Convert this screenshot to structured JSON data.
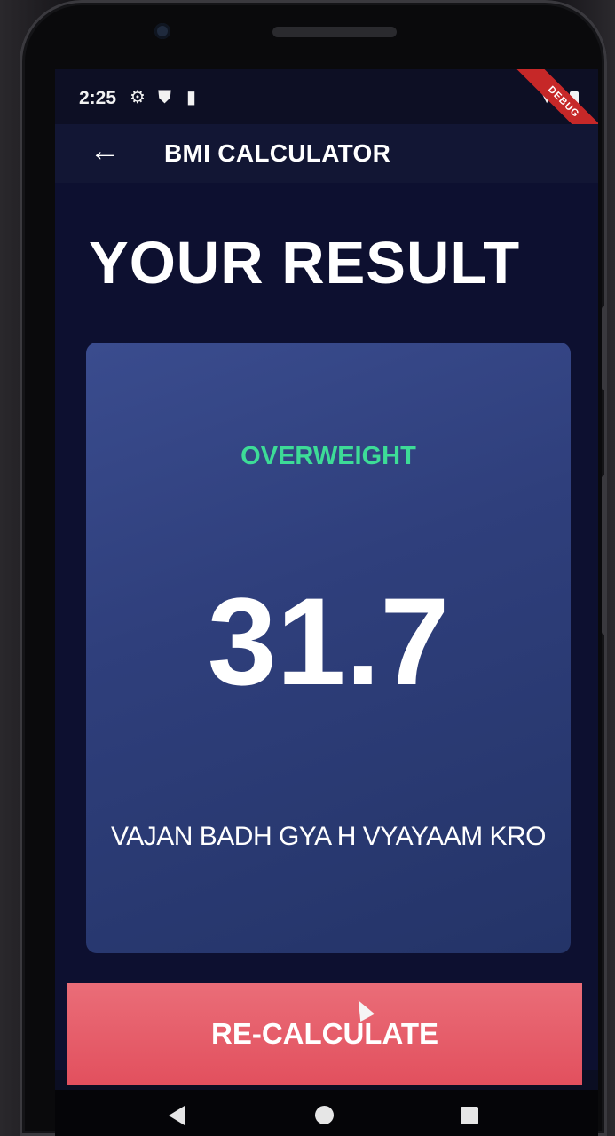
{
  "status_bar": {
    "time": "2:25",
    "icons": [
      "settings-icon",
      "shield-icon",
      "sd-card-icon",
      "wifi-icon",
      "signal-icon",
      "battery-icon"
    ],
    "debug_banner": "DEBUG"
  },
  "app_bar": {
    "back_icon": "arrow-left-icon",
    "title": "BMI CALCULATOR"
  },
  "heading": "YOUR RESULT",
  "result": {
    "category": "OVERWEIGHT",
    "bmi": "31.7",
    "advice": "VAJAN BADH GYA H VYAYAAM KRO"
  },
  "recalculate_label": "RE-CALCULATE",
  "nav_bar": {
    "icons": [
      "back-triangle-icon",
      "home-circle-icon",
      "recents-square-icon"
    ]
  },
  "colors": {
    "background": "#0d1030",
    "card": "#2f3f7c",
    "category_text": "#3ddc97",
    "button": "#e5566a",
    "text": "#ffffff"
  }
}
